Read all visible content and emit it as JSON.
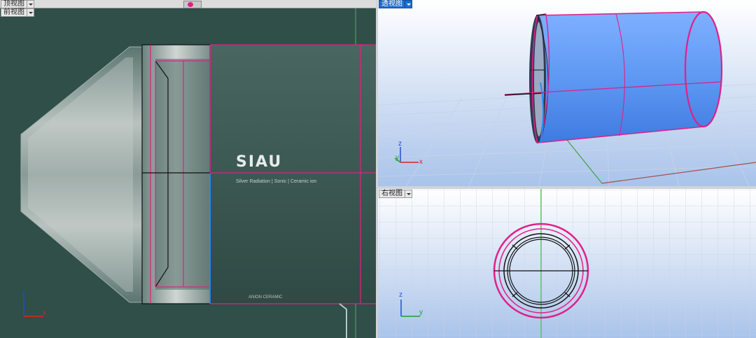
{
  "viewports": {
    "top": {
      "label": "顶视图"
    },
    "front": {
      "label": "前视图",
      "logo_text": "SIAU",
      "tagline": "Silver Radiation | Sonic | Ceramic ion",
      "bottom_text": "ANION CERAMIC"
    },
    "perspective": {
      "label": "透视图"
    },
    "right": {
      "label": "右视图"
    }
  },
  "axes": {
    "front": {
      "v": "z",
      "h": "x"
    },
    "perspective": {
      "v": "z",
      "h": "x",
      "d": "y"
    },
    "right": {
      "v": "z",
      "h": "y"
    }
  },
  "colors": {
    "edge_magenta": "#e0208a",
    "edge_blue": "#1e90ff",
    "cylinder_blue": "#5b96f2",
    "front_bg": "#2f4f48",
    "persp_bg_top": "#ffffff",
    "persp_bg_bottom": "#a9c3ea",
    "grid": "#c7d3e6"
  }
}
